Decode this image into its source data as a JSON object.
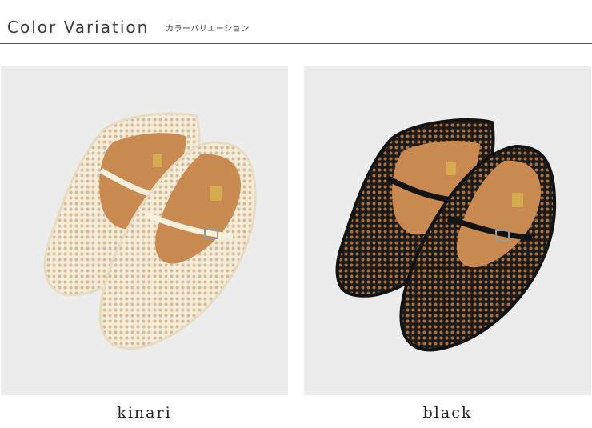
{
  "header": {
    "title": "Color Variation",
    "subtitle": "カラーバリエーション"
  },
  "variants": [
    {
      "label": "kinari",
      "upper_color": "#f1ead8",
      "strap_color": "#f5efdc",
      "insole_color": "#c98a52"
    },
    {
      "label": "black",
      "upper_color": "#1e1c1b",
      "strap_color": "#141313",
      "insole_color": "#c98a52"
    }
  ]
}
